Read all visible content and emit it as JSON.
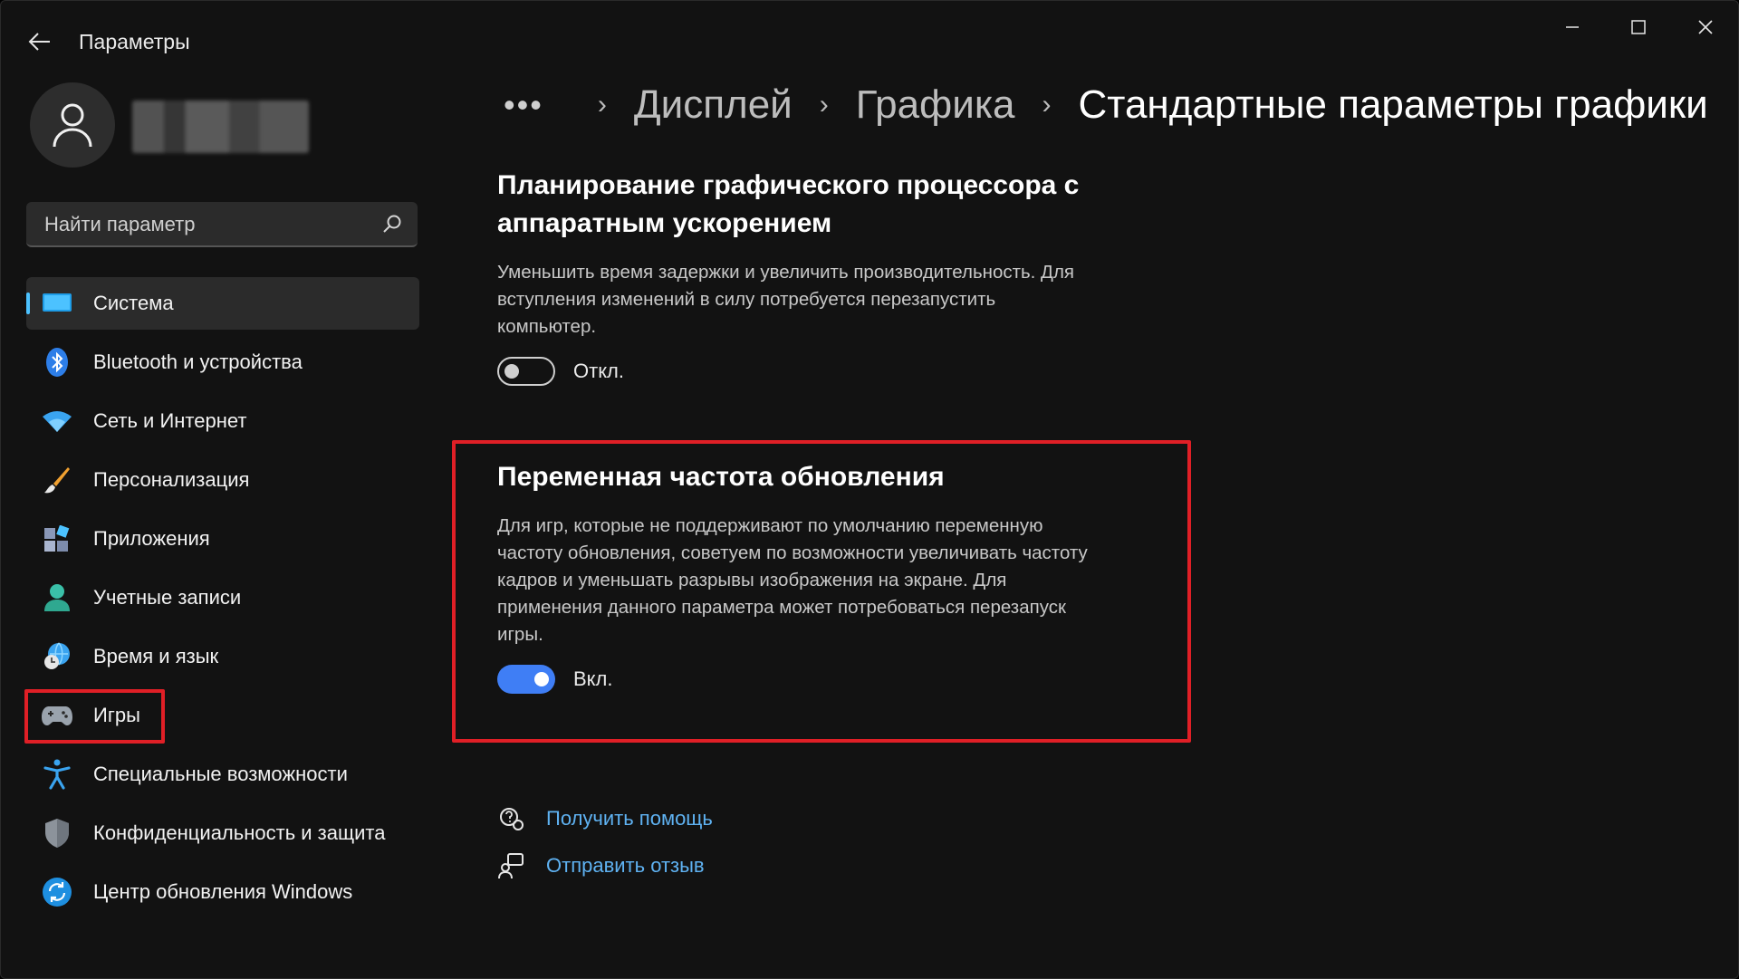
{
  "window": {
    "title": "Параметры"
  },
  "search": {
    "placeholder": "Найти параметр"
  },
  "sidebar": {
    "items": [
      {
        "label": "Система",
        "icon": "monitor-icon",
        "active": true
      },
      {
        "label": "Bluetooth и устройства",
        "icon": "bluetooth-icon"
      },
      {
        "label": "Сеть и Интернет",
        "icon": "wifi-icon"
      },
      {
        "label": "Персонализация",
        "icon": "brush-icon"
      },
      {
        "label": "Приложения",
        "icon": "apps-icon"
      },
      {
        "label": "Учетные записи",
        "icon": "person-icon"
      },
      {
        "label": "Время и язык",
        "icon": "globe-clock-icon"
      },
      {
        "label": "Игры",
        "icon": "gamepad-icon",
        "highlighted": true
      },
      {
        "label": "Специальные возможности",
        "icon": "accessibility-icon"
      },
      {
        "label": "Конфиденциальность и защита",
        "icon": "shield-icon"
      },
      {
        "label": "Центр обновления Windows",
        "icon": "update-icon"
      }
    ]
  },
  "breadcrumb": {
    "more": "•••",
    "items": [
      "Дисплей",
      "Графика",
      "Стандартные параметры графики"
    ]
  },
  "gpu_scheduling": {
    "title_line1": "Планирование графического процессора с",
    "title_line2": "аппаратным ускорением",
    "desc_line1": "Уменьшить время задержки и увеличить производительность. Для",
    "desc_line2": "вступления изменений в силу потребуется перезапустить",
    "desc_line3": "компьютер.",
    "toggle_state": "off",
    "toggle_label": "Откл."
  },
  "variable_refresh": {
    "title": "Переменная частота обновления",
    "desc_line1": "Для игр, которые не поддерживают по умолчанию переменную",
    "desc_line2": "частоту обновления, советуем по возможности увеличивать частоту",
    "desc_line3": "кадров и уменьшать разрывы изображения на экране. Для",
    "desc_line4": "применения данного параметра может потребоваться перезапуск",
    "desc_line5": "игры.",
    "toggle_state": "on",
    "toggle_label": "Вкл."
  },
  "links": {
    "help": "Получить помощь",
    "feedback": "Отправить отзыв"
  },
  "colors": {
    "accent": "#4cc2ff",
    "toggle_on": "#3f7ef5",
    "link": "#5fb2f2",
    "highlight": "#e01f26"
  }
}
